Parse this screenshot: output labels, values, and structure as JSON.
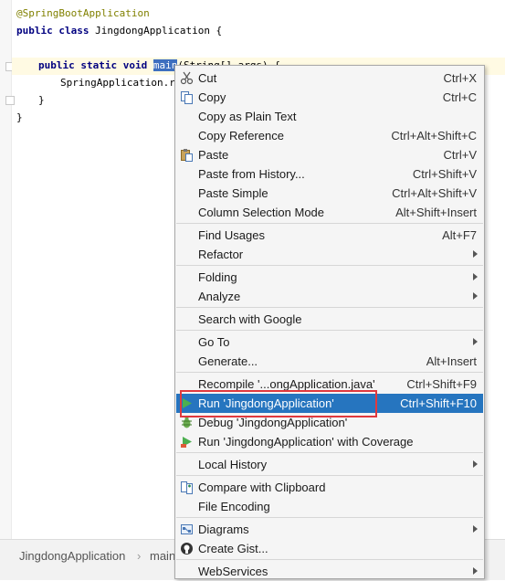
{
  "editor": {
    "annotation": "@SpringBootApplication",
    "class_decl": {
      "kw": "public class",
      "name": " JingdongApplication {"
    },
    "main_decl": {
      "kw": "public static void",
      "sel": "main",
      "rest": "(String[] args) {"
    },
    "run_call": "SpringApplication.run",
    "close_inner": "}",
    "close_outer": "}"
  },
  "status": {
    "crumb1": "JingdongApplication",
    "sep": "›",
    "crumb2": "main"
  },
  "menu": {
    "cut": "Cut",
    "cut_sc": "Ctrl+X",
    "copy": "Copy",
    "copy_sc": "Ctrl+C",
    "copy_plain": "Copy as Plain Text",
    "copy_ref": "Copy Reference",
    "copy_ref_sc": "Ctrl+Alt+Shift+C",
    "paste": "Paste",
    "paste_sc": "Ctrl+V",
    "paste_history": "Paste from History...",
    "paste_history_sc": "Ctrl+Shift+V",
    "paste_simple": "Paste Simple",
    "paste_simple_sc": "Ctrl+Alt+Shift+V",
    "column_sel": "Column Selection Mode",
    "column_sel_sc": "Alt+Shift+Insert",
    "find_usages": "Find Usages",
    "find_usages_sc": "Alt+F7",
    "refactor": "Refactor",
    "folding": "Folding",
    "analyze": "Analyze",
    "search_google": "Search with Google",
    "go_to": "Go To",
    "generate": "Generate...",
    "generate_sc": "Alt+Insert",
    "recompile": "Recompile '...ongApplication.java'",
    "recompile_sc": "Ctrl+Shift+F9",
    "run": "Run 'JingdongApplication'",
    "run_sc": "Ctrl+Shift+F10",
    "debug": "Debug 'JingdongApplication'",
    "run_coverage": "Run 'JingdongApplication' with Coverage",
    "local_history": "Local History",
    "compare_clipboard": "Compare with Clipboard",
    "file_encoding": "File Encoding",
    "diagrams": "Diagrams",
    "create_gist": "Create Gist...",
    "webservices": "WebServices"
  },
  "colors": {
    "highlight": "#2675bf",
    "red_box": "#e0393e",
    "annotation": "#808000",
    "keyword": "#000080"
  }
}
